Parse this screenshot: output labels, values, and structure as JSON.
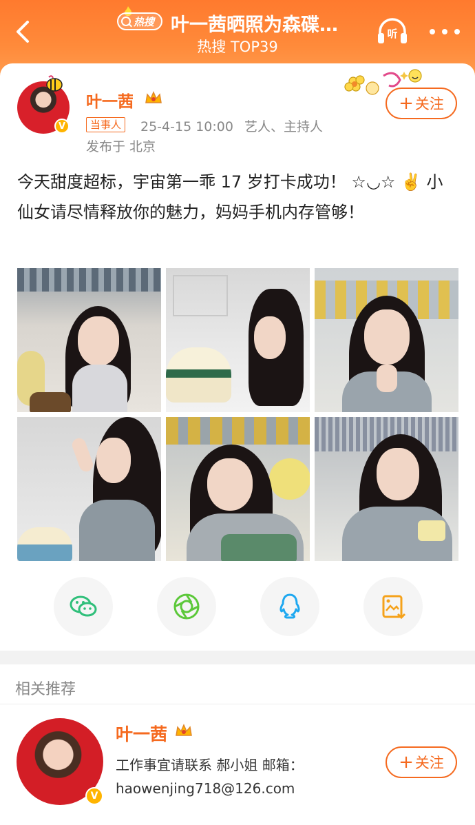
{
  "header": {
    "badge_label": "热搜",
    "title": "叶一茜晒照为森碟…",
    "subtitle": "热搜 TOP39",
    "listen_label": "听"
  },
  "post": {
    "user_name": "叶一茜",
    "role_tag": "当事人",
    "timestamp": "25-4-15 10:00",
    "user_title": "艺人、主持人",
    "location": "发布于 北京",
    "follow_label": "关注",
    "text": "今天甜度超标，宇宙第一乖 17 岁打卡成功！ ☆◡☆ ✌️ 小仙女请尽情释放你的魅力，妈妈手机内存管够！",
    "photos": 6
  },
  "share": {
    "items": [
      "wechat-icon",
      "moments-icon",
      "qq-icon",
      "save-image-icon"
    ]
  },
  "related": {
    "title": "相关推荐",
    "user_name": "叶一茜",
    "desc_line1": "工作事宜请联系 郝小姐 邮箱：",
    "desc_line2": "haowenjing718@126.com",
    "follow_label": "关注"
  },
  "colors": {
    "accent": "#f56a1f",
    "header_gradient_top": "#ff7a2e",
    "verify_badge": "#ffb400"
  }
}
